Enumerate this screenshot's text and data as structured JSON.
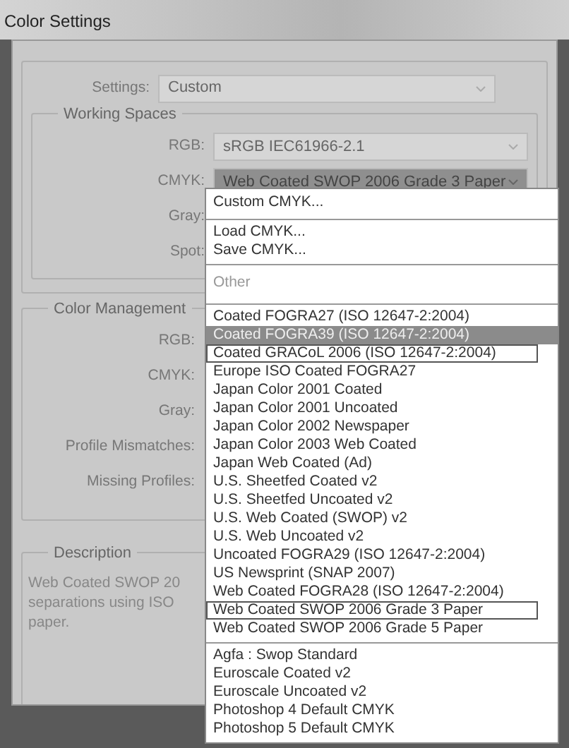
{
  "window": {
    "title": "Color Settings"
  },
  "settings": {
    "label": "Settings:",
    "value": "Custom"
  },
  "working_spaces": {
    "legend": "Working Spaces",
    "rows": [
      {
        "label": "RGB:",
        "value": "sRGB IEC61966-2.1",
        "open": false
      },
      {
        "label": "CMYK:",
        "value": "Web Coated SWOP 2006 Grade 3 Paper",
        "open": true
      },
      {
        "label": "Gray:"
      },
      {
        "label": "Spot:"
      }
    ]
  },
  "color_management": {
    "legend": "Color Management",
    "rows": [
      {
        "label": "RGB:"
      },
      {
        "label": "CMYK:"
      },
      {
        "label": "Gray:"
      },
      {
        "label": "Profile Mismatches:"
      },
      {
        "label": "Missing Profiles:"
      }
    ]
  },
  "description": {
    "legend": "Description",
    "lines": [
      "Web Coated SWOP 20",
      "separations using ISO",
      "paper."
    ]
  },
  "menu": {
    "groups": [
      {
        "items": [
          {
            "label": "Custom CMYK...",
            "disabled": false,
            "highlighted": false,
            "outlined": false
          }
        ]
      },
      {
        "items": [
          {
            "label": "Load CMYK...",
            "disabled": false,
            "highlighted": false,
            "outlined": false
          },
          {
            "label": "Save CMYK...",
            "disabled": false,
            "highlighted": false,
            "outlined": false
          }
        ]
      },
      {
        "items": [
          {
            "label": "Other",
            "disabled": true,
            "highlighted": false,
            "outlined": false
          }
        ]
      },
      {
        "items": [
          {
            "label": "Coated FOGRA27 (ISO 12647-2:2004)",
            "disabled": false,
            "highlighted": false,
            "outlined": false
          },
          {
            "label": "Coated FOGRA39 (ISO 12647-2:2004)",
            "disabled": false,
            "highlighted": true,
            "outlined": false
          },
          {
            "label": "Coated GRACoL 2006 (ISO 12647-2:2004)",
            "disabled": false,
            "highlighted": false,
            "outlined": true
          },
          {
            "label": "Europe ISO Coated FOGRA27",
            "disabled": false,
            "highlighted": false,
            "outlined": false
          },
          {
            "label": "Japan Color 2001 Coated",
            "disabled": false,
            "highlighted": false,
            "outlined": false
          },
          {
            "label": "Japan Color 2001 Uncoated",
            "disabled": false,
            "highlighted": false,
            "outlined": false
          },
          {
            "label": "Japan Color 2002 Newspaper",
            "disabled": false,
            "highlighted": false,
            "outlined": false
          },
          {
            "label": "Japan Color 2003 Web Coated",
            "disabled": false,
            "highlighted": false,
            "outlined": false
          },
          {
            "label": "Japan Web Coated (Ad)",
            "disabled": false,
            "highlighted": false,
            "outlined": false
          },
          {
            "label": "U.S. Sheetfed Coated v2",
            "disabled": false,
            "highlighted": false,
            "outlined": false
          },
          {
            "label": "U.S. Sheetfed Uncoated v2",
            "disabled": false,
            "highlighted": false,
            "outlined": false
          },
          {
            "label": "U.S. Web Coated (SWOP) v2",
            "disabled": false,
            "highlighted": false,
            "outlined": false
          },
          {
            "label": "U.S. Web Uncoated v2",
            "disabled": false,
            "highlighted": false,
            "outlined": false
          },
          {
            "label": "Uncoated FOGRA29 (ISO 12647-2:2004)",
            "disabled": false,
            "highlighted": false,
            "outlined": false
          },
          {
            "label": "US Newsprint (SNAP 2007)",
            "disabled": false,
            "highlighted": false,
            "outlined": false
          },
          {
            "label": "Web Coated FOGRA28 (ISO 12647-2:2004)",
            "disabled": false,
            "highlighted": false,
            "outlined": false
          },
          {
            "label": "Web Coated SWOP 2006 Grade 3 Paper",
            "disabled": false,
            "highlighted": false,
            "outlined": true
          },
          {
            "label": "Web Coated SWOP 2006 Grade 5 Paper",
            "disabled": false,
            "highlighted": false,
            "outlined": false
          }
        ]
      },
      {
        "items": [
          {
            "label": "Agfa : Swop Standard",
            "disabled": false,
            "highlighted": false,
            "outlined": false
          },
          {
            "label": "Euroscale Coated v2",
            "disabled": false,
            "highlighted": false,
            "outlined": false
          },
          {
            "label": "Euroscale Uncoated v2",
            "disabled": false,
            "highlighted": false,
            "outlined": false
          },
          {
            "label": "Photoshop 4 Default CMYK",
            "disabled": false,
            "highlighted": false,
            "outlined": false
          },
          {
            "label": "Photoshop 5 Default CMYK",
            "disabled": false,
            "highlighted": false,
            "outlined": false
          }
        ]
      }
    ]
  }
}
